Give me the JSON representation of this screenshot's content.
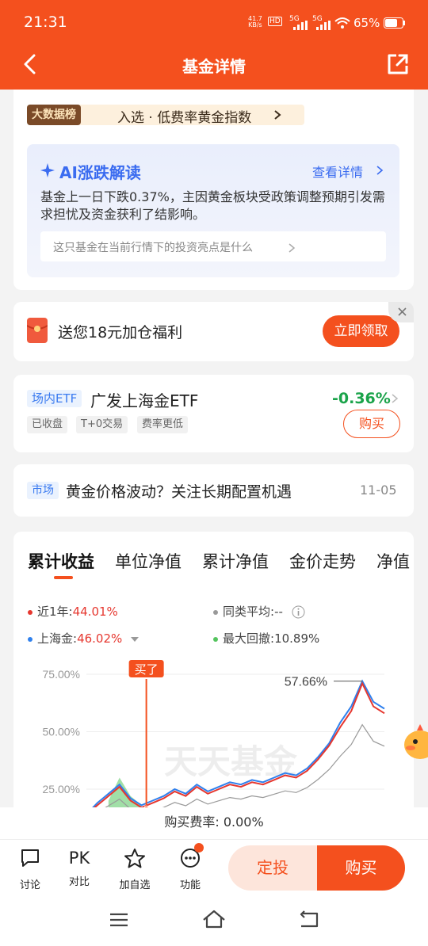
{
  "status_bar": {
    "time": "21:31",
    "net_speed_top": "41.7",
    "net_speed_unit": "KB/s",
    "hd": "HD",
    "sig1": "5G",
    "sig2": "5G",
    "battery": "65%"
  },
  "nav": {
    "title": "基金详情"
  },
  "rank_banner": {
    "badge": "大数据榜",
    "text": "入选 · 低费率黄金指数"
  },
  "ai": {
    "title": "AI涨跌解读",
    "link": "查看详情",
    "text": "基金上一日下跌0.37%，主因黄金板块受政策调整预期引发需求担忧及资金获利了结影响。",
    "prompt": "这只基金在当前行情下的投资亮点是什么"
  },
  "promo": {
    "text": "送您18元加仓福利",
    "button": "立即领取"
  },
  "etf": {
    "tag": "场内ETF",
    "name": "广发上海金ETF",
    "change": "-0.36%",
    "badges": [
      "已收盘",
      "T+0交易",
      "费率更低"
    ],
    "button": "购买"
  },
  "market": {
    "tag": "市场",
    "title": "黄金价格波动？关注长期配置机遇",
    "date": "11-05"
  },
  "tabs": [
    "累计收益",
    "单位净值",
    "累计净值",
    "金价走势",
    "净值"
  ],
  "legend": {
    "fund_label": "近1年:",
    "fund_value": "44.01%",
    "peer_label": "同类平均:",
    "peer_value": "--",
    "index_label": "上海金:",
    "index_value": "46.02%",
    "drawdown_label": "最大回撤:",
    "drawdown_value": "10.89%"
  },
  "chart_data": {
    "type": "line",
    "y_ticks": [
      "75.00%",
      "50.00%",
      "25.00%"
    ],
    "buy_marker": "买了",
    "peak_label": "57.66%",
    "watermark": "天天基金",
    "series": [
      {
        "name": "近1年",
        "color": "#e6372f",
        "values": [
          0,
          4,
          8,
          12,
          6,
          3,
          5,
          7,
          10,
          8,
          12,
          9,
          11,
          13,
          12,
          14,
          13,
          15,
          17,
          16,
          19,
          24,
          30,
          38,
          45,
          57,
          47,
          44
        ]
      },
      {
        "name": "上海金",
        "color": "#2f80ed",
        "values": [
          0,
          5,
          9,
          13,
          7,
          4,
          6,
          8,
          11,
          9,
          13,
          10,
          12,
          14,
          13,
          15,
          14,
          16,
          18,
          17,
          20,
          25,
          31,
          40,
          47,
          58,
          49,
          46
        ]
      }
    ],
    "colors": {
      "fund": "#e6372f",
      "index": "#2f80ed",
      "peer": "#999999",
      "drawdown": "#54c45e"
    }
  },
  "footer": {
    "fee_label": "购买费率:",
    "fee_value": "0.00%"
  },
  "bottom_bar": {
    "items": [
      "讨论",
      "对比",
      "加自选",
      "功能"
    ],
    "pk": "PK",
    "sip": "定投",
    "buy": "购买"
  }
}
